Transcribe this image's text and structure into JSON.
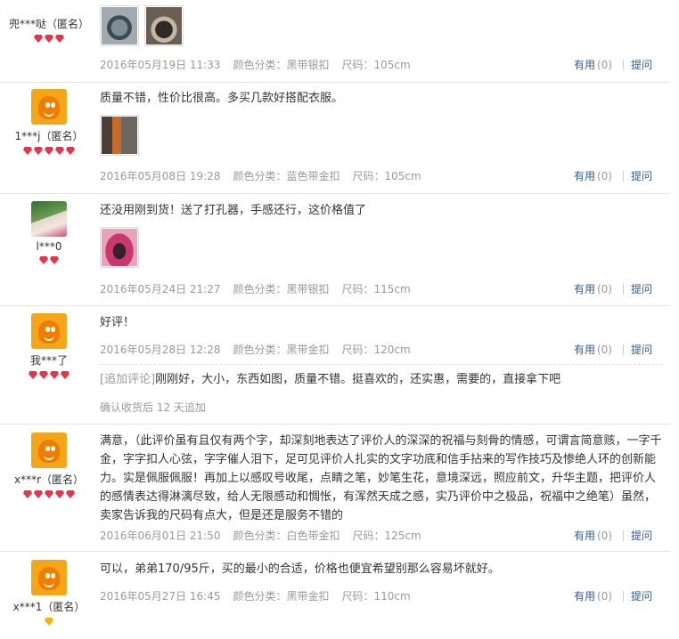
{
  "actions": {
    "useful": "有用",
    "count": "(0)",
    "ask": "提问"
  },
  "reviews": [
    {
      "user": "兜***哒（匿名）",
      "date": "2016年05月19日 11:33",
      "sku": "颜色分类：黑带银扣",
      "size": "尺码：105cm"
    },
    {
      "user": "1***j（匿名）",
      "text": "质量不错，性价比很高。多买几款好搭配衣服。",
      "date": "2016年05月08日 19:28",
      "sku": "颜色分类：蓝色带金扣",
      "size": "尺码：105cm"
    },
    {
      "user": "l***0",
      "text": "还没用刚到货！送了打孔器，手感还行，这价格值了",
      "date": "2016年05月24日 21:27",
      "sku": "颜色分类：黑带银扣",
      "size": "尺码：115cm"
    },
    {
      "user": "我***了",
      "text": "好评！",
      "date": "2016年05月28日 12:28",
      "sku": "颜色分类：黑带金扣",
      "size": "尺码：120cm",
      "append_label": "[追加评论]",
      "append_text": "刚刚好，大小，东西如图，质量不错。挺喜欢的，还实惠，需要的，直接拿下吧",
      "append_note": "确认收货后 12 天追加"
    },
    {
      "user": "x***r（匿名）",
      "text": "满意，（此评价虽有且仅有两个字，却深刻地表达了评价人的深深的祝福与刻骨的情感，可谓言简意赅，一字千金，字字扣人心弦，字字催人泪下，足可见评价人扎实的文字功底和信手拈来的写作技巧及惨绝人环的创新能力。实是佩服佩服！再加上以感叹号收尾，点睛之笔，妙笔生花，意境深远，照应前文，升华主题，把评价人的感情表达得淋漓尽致，给人无限感动和惆怅，有浑然天成之感，实乃评价中之极品，祝福中之绝笔）虽然，卖家告诉我的尺码有点大，但是还是服务不错的",
      "date": "2016年06月01日 21:50",
      "sku": "颜色分类：白色带金扣",
      "size": "尺码：125cm"
    },
    {
      "user": "x***1（匿名）",
      "text": "可以，弟弟170/95斤，买的最小的合适，价格也便宜希望别那么容易坏就好。",
      "date": "2016年05月27日 16:45",
      "sku": "颜色分类：黑带金扣",
      "size": "尺码：110cm"
    }
  ]
}
